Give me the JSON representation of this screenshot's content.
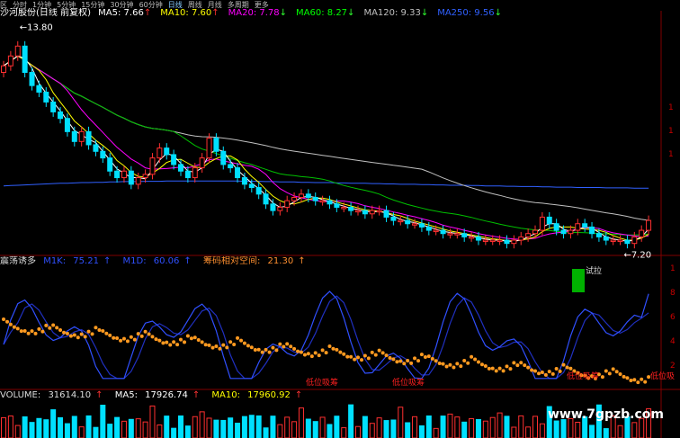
{
  "topbar": {
    "items": [
      "区",
      "分时",
      "1分钟",
      "5分钟",
      "15分钟",
      "30分钟",
      "60分钟",
      "日线",
      "周线",
      "月线",
      "多周期",
      "更多"
    ],
    "active_index": 7
  },
  "main": {
    "title": "沙河股份(日线 前复权)",
    "ma": [
      {
        "label": "MA5:",
        "value": "7.66",
        "arrow": "↑",
        "color": "#ffffff"
      },
      {
        "label": "MA10:",
        "value": "7.60",
        "arrow": "↑",
        "color": "#ffff00"
      },
      {
        "label": "MA20:",
        "value": "7.78",
        "arrow": "↓",
        "color": "#ff00ff"
      },
      {
        "label": "MA60:",
        "value": "8.27",
        "arrow": "↓",
        "color": "#00ff00"
      },
      {
        "label": "MA120:",
        "value": "9.33",
        "arrow": "↓",
        "color": "#c0c0c0"
      },
      {
        "label": "MA250:",
        "value": "9.56",
        "arrow": "↓",
        "color": "#3060ff"
      }
    ],
    "high_marker": "13.80",
    "low_marker": "7.20",
    "right_ticks": [
      "1",
      "1",
      "1"
    ]
  },
  "indicator": {
    "name": "震荡诱多",
    "k_label": "M1K:",
    "k_value": "75.21",
    "k_arrow": "↑",
    "d_label": "M1D:",
    "d_value": "60.06",
    "d_arrow": "↑",
    "chip_label": "筹码相对空间:",
    "chip_value": "21.30",
    "chip_arrow": "↑",
    "signal_text": "试拉",
    "low_chip_labels": [
      "低位吸筹",
      "低位吸筹",
      "低位吸筹",
      "低位吸"
    ],
    "right_ticks": [
      "1",
      "8",
      "6",
      "4",
      "2"
    ]
  },
  "volume": {
    "label": "VOLUME:",
    "value": "31614.10",
    "value_arrow": "↑",
    "ma5_label": "MA5:",
    "ma5_value": "17926.74",
    "ma5_arrow": "↑",
    "ma10_label": "MA10:",
    "ma10_value": "17960.92",
    "ma10_arrow": "↑"
  },
  "watermark": "www.7gpzb.com",
  "chart_data": {
    "type": "line",
    "price": {
      "x": [
        0,
        8,
        16,
        24,
        32,
        40,
        48,
        56,
        64,
        72,
        80,
        88,
        96,
        104,
        112,
        120,
        128,
        136,
        144,
        152,
        160,
        168,
        176,
        184,
        192,
        200,
        208,
        216,
        224,
        232,
        240,
        248,
        256,
        264,
        272,
        280,
        288,
        296,
        304,
        312,
        320,
        328,
        336,
        344,
        352,
        360,
        368,
        376,
        384,
        392,
        400,
        408,
        416,
        424,
        432,
        440,
        448,
        456,
        464,
        472,
        480,
        488,
        496,
        504,
        512,
        520,
        528,
        536,
        544,
        552,
        560,
        568,
        576,
        584,
        592,
        600,
        608,
        616,
        624,
        632,
        640,
        648,
        656,
        664,
        672,
        680,
        688,
        696,
        704,
        712,
        720,
        728
      ],
      "close": [
        12.6,
        12.9,
        13.2,
        12.4,
        12.0,
        11.8,
        11.5,
        11.2,
        11.0,
        10.6,
        10.3,
        10.6,
        10.2,
        10.0,
        9.8,
        9.4,
        9.2,
        9.4,
        9.0,
        9.2,
        9.3,
        9.8,
        10.1,
        9.9,
        9.6,
        9.4,
        9.2,
        9.5,
        9.8,
        10.4,
        10.0,
        9.6,
        9.5,
        9.2,
        9.0,
        8.9,
        8.7,
        8.4,
        8.2,
        8.3,
        8.5,
        8.6,
        8.7,
        8.6,
        8.5,
        8.5,
        8.4,
        8.3,
        8.3,
        8.2,
        8.2,
        8.1,
        8.2,
        8.2,
        8.0,
        7.9,
        7.9,
        7.8,
        7.8,
        7.7,
        7.6,
        7.6,
        7.5,
        7.5,
        7.5,
        7.4,
        7.4,
        7.3,
        7.3,
        7.3,
        7.3,
        7.2,
        7.3,
        7.4,
        7.5,
        7.6,
        8.0,
        7.8,
        7.6,
        7.5,
        7.6,
        7.8,
        7.7,
        7.5,
        7.4,
        7.3,
        7.3,
        7.3,
        7.2,
        7.4,
        7.6,
        7.9
      ],
      "ma250": [
        8.95,
        8.96,
        8.97,
        8.98,
        8.99,
        9.0,
        9.01,
        9.02,
        9.03,
        9.03,
        9.04,
        9.05,
        9.05,
        9.06,
        9.06,
        9.07,
        9.07,
        9.08,
        9.08,
        9.08,
        9.09,
        9.09,
        9.09,
        9.1,
        9.1,
        9.1,
        9.1,
        9.1,
        9.1,
        9.1,
        9.1,
        9.1,
        9.1,
        9.1,
        9.09,
        9.09,
        9.09,
        9.08,
        9.08,
        9.07,
        9.07,
        9.07,
        9.06,
        9.06,
        9.05,
        9.05,
        9.05,
        9.04,
        9.04,
        9.03,
        9.03,
        9.03,
        9.02,
        9.02,
        9.01,
        9.01,
        9.0,
        9.0,
        9.0,
        8.99,
        8.99,
        8.98,
        8.98,
        8.97,
        8.97,
        8.97,
        8.96,
        8.96,
        8.95,
        8.95,
        8.95,
        8.94,
        8.94,
        8.93,
        8.93,
        8.93,
        8.92,
        8.92,
        8.91,
        8.91,
        8.91,
        8.9,
        8.9,
        8.9,
        8.9,
        8.89,
        8.89,
        8.89,
        8.89,
        8.88,
        8.88,
        8.88
      ]
    },
    "price_ylim": [
      7.0,
      14.0
    ],
    "indicator_ylim": [
      0,
      100
    ],
    "volume_ylim": [
      0,
      40000
    ]
  }
}
